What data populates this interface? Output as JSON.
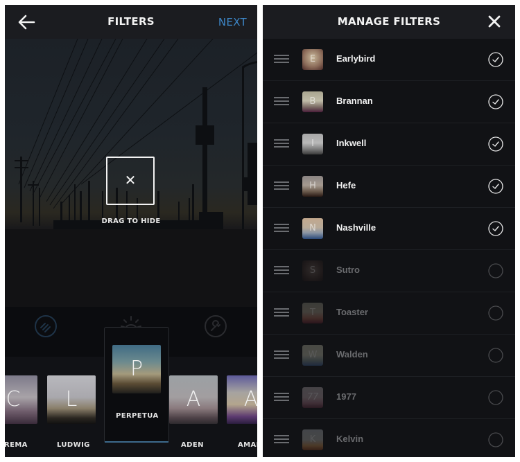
{
  "filters_screen": {
    "title": "FILTERS",
    "back_icon": "arrow-left-icon",
    "next_label": "NEXT",
    "drag_to_hide": {
      "icon": "close-x-icon",
      "label": "DRAG TO HIDE"
    },
    "tools": [
      {
        "name": "lux",
        "icon": "magic-wand-circle-icon"
      },
      {
        "name": "brightness",
        "icon": "sun-icon"
      },
      {
        "name": "edit",
        "icon": "wrench-circle-icon"
      }
    ],
    "filter_strip": [
      {
        "letter": "C",
        "label": "CREMA",
        "visible_label": "REMA"
      },
      {
        "letter": "L",
        "label": "LUDWIG"
      },
      {
        "letter": "P",
        "label": "PERPETUA",
        "selected": true
      },
      {
        "letter": "A",
        "label": "ADEN"
      },
      {
        "letter": "A",
        "label": "AMARO",
        "visible_label": "AMAR"
      }
    ]
  },
  "manage_screen": {
    "title": "MANAGE FILTERS",
    "close_icon": "close-x-icon",
    "filters": [
      {
        "letter": "E",
        "name": "Earlybird",
        "enabled": true
      },
      {
        "letter": "B",
        "name": "Brannan",
        "enabled": true
      },
      {
        "letter": "I",
        "name": "Inkwell",
        "enabled": true
      },
      {
        "letter": "H",
        "name": "Hefe",
        "enabled": true
      },
      {
        "letter": "N",
        "name": "Nashville",
        "enabled": true
      },
      {
        "letter": "S",
        "name": "Sutro",
        "enabled": false
      },
      {
        "letter": "T",
        "name": "Toaster",
        "enabled": false
      },
      {
        "letter": "W",
        "name": "Walden",
        "enabled": false
      },
      {
        "letter": "77",
        "name": "1977",
        "enabled": false
      },
      {
        "letter": "K",
        "name": "Kelvin",
        "enabled": false
      }
    ]
  },
  "colors": {
    "accent": "#3d86c6",
    "background": "#121316",
    "topbar": "#1b1c20",
    "enabled_text": "#f2f2f2",
    "disabled_text": "#6a6b6e"
  }
}
